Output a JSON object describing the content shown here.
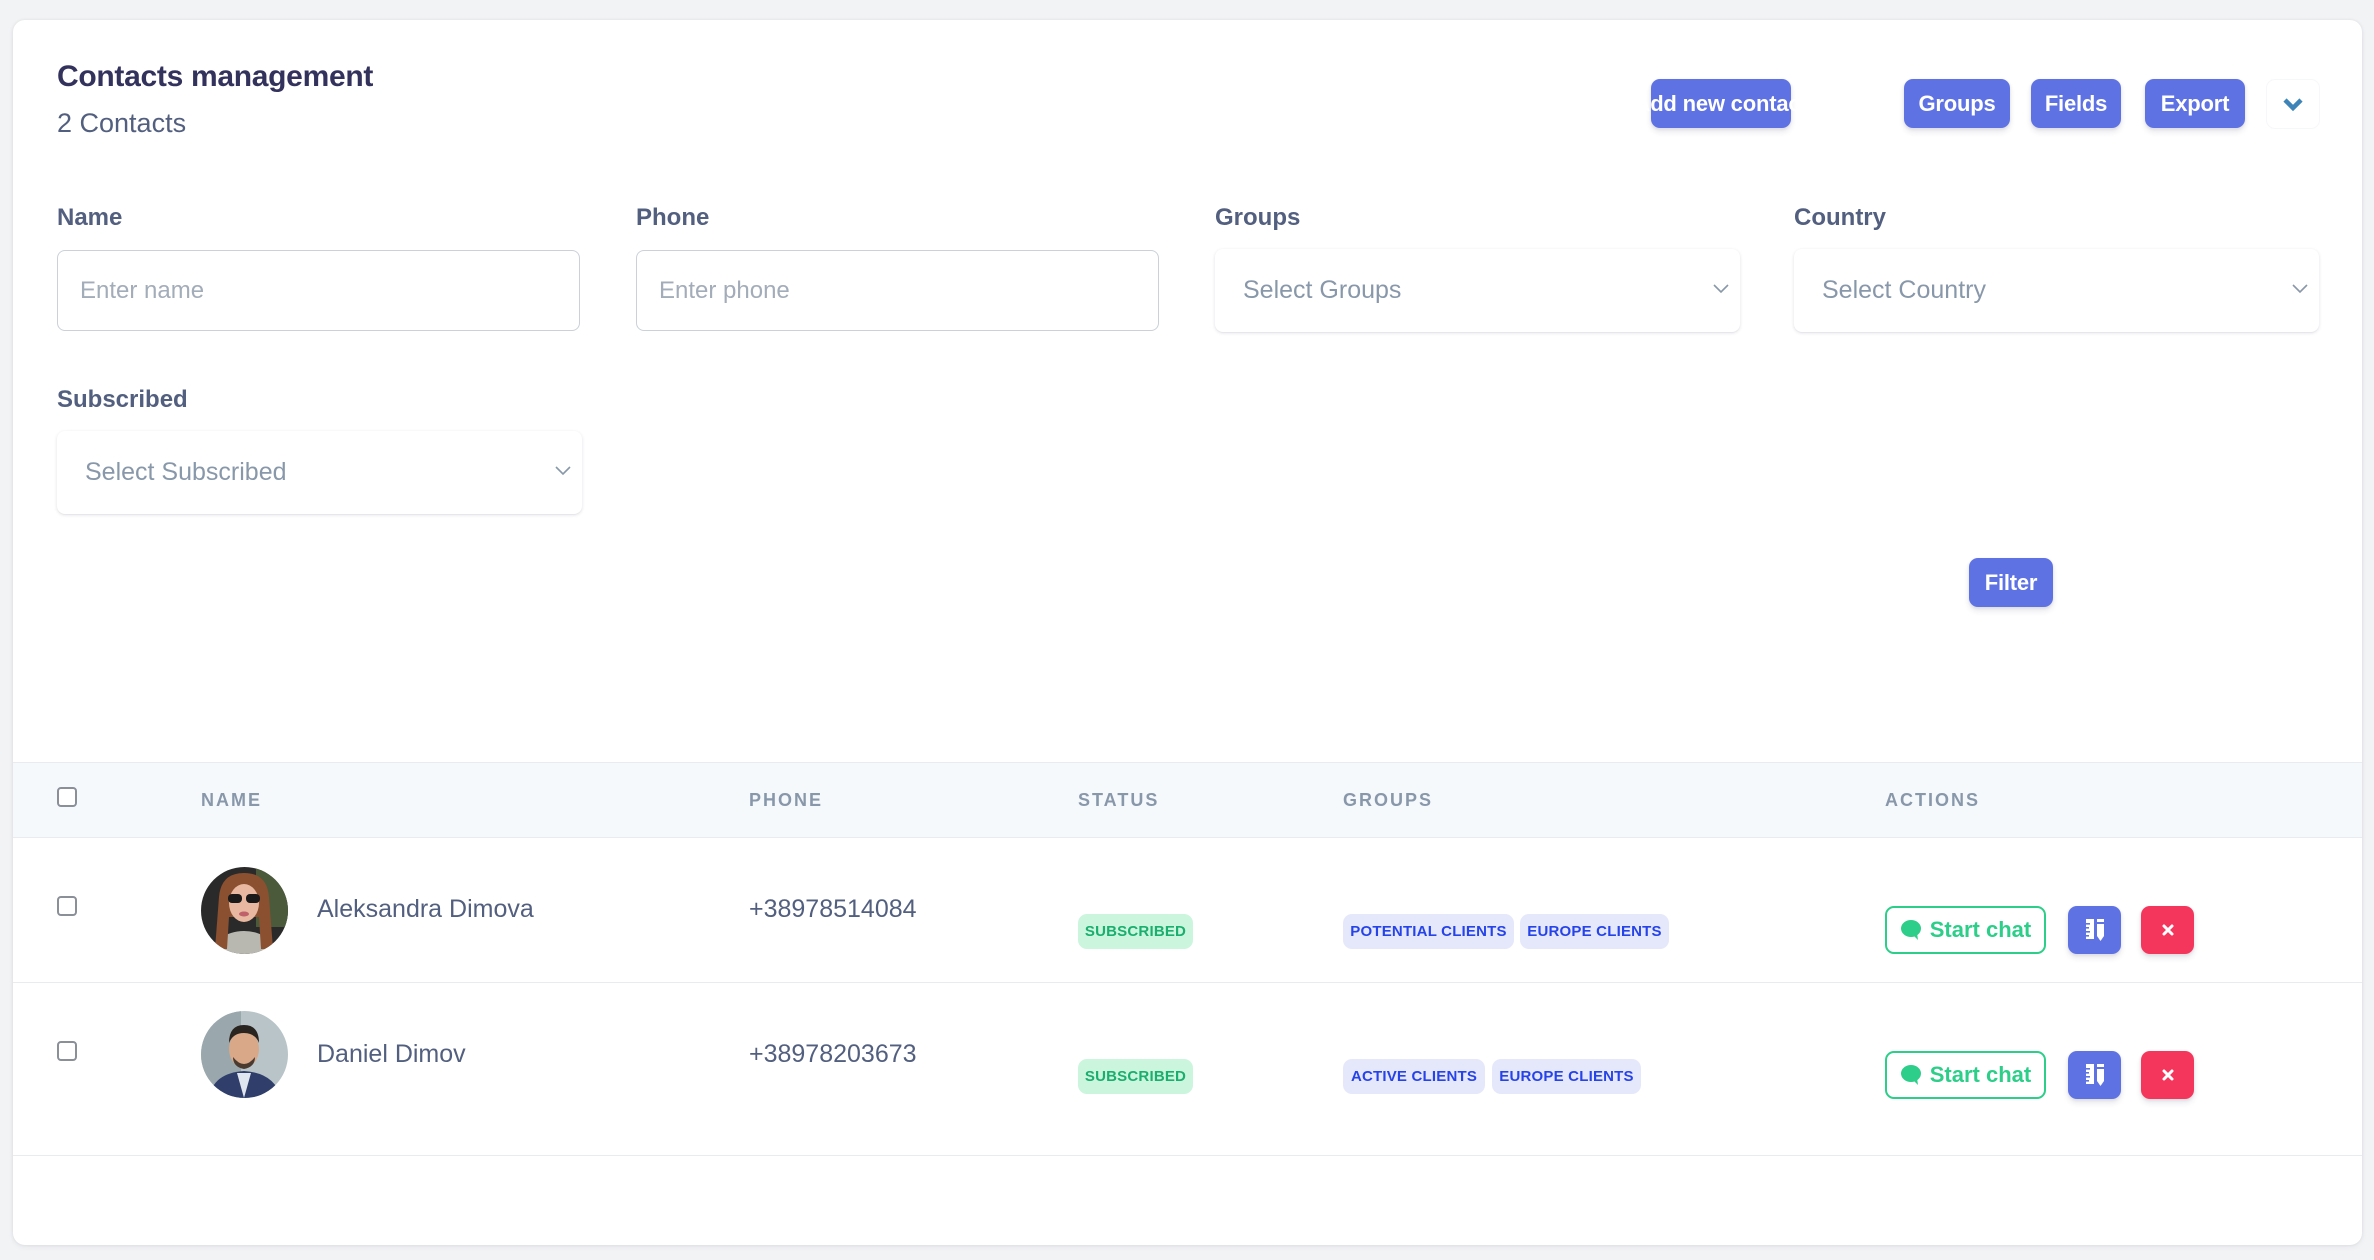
{
  "header": {
    "title": "Contacts management",
    "subtitle": "2 Contacts",
    "buttons": {
      "add": "Add new contact",
      "groups": "Groups",
      "fields": "Fields",
      "export": "Export"
    },
    "more_icon": "chevron-down-icon"
  },
  "filters": {
    "name": {
      "label": "Name",
      "placeholder": "Enter name",
      "value": ""
    },
    "phone": {
      "label": "Phone",
      "placeholder": "Enter phone",
      "value": ""
    },
    "groups": {
      "label": "Groups",
      "selected": "Select Groups"
    },
    "country": {
      "label": "Country",
      "selected": "Select Country"
    },
    "subscribed": {
      "label": "Subscribed",
      "selected": "Select Subscribed"
    },
    "filter_button": "Filter"
  },
  "table": {
    "columns": [
      "NAME",
      "PHONE",
      "STATUS",
      "GROUPS",
      "ACTIONS"
    ],
    "rows": [
      {
        "name": "Aleksandra Dimova",
        "phone": "+38978514084",
        "status": "SUBSCRIBED",
        "groups": [
          "POTENTIAL CLIENTS",
          "EUROPE CLIENTS"
        ],
        "chat_label": "Start chat",
        "checked": false
      },
      {
        "name": "Daniel Dimov",
        "phone": "+38978203673",
        "status": "SUBSCRIBED",
        "groups": [
          "ACTIVE CLIENTS",
          "EUROPE CLIENTS"
        ],
        "chat_label": "Start chat",
        "checked": false
      }
    ]
  },
  "colors": {
    "primary": "#5e72e4",
    "success": "#2dce89",
    "danger": "#f5365c",
    "heading": "#32325d",
    "text": "#525f7f"
  }
}
